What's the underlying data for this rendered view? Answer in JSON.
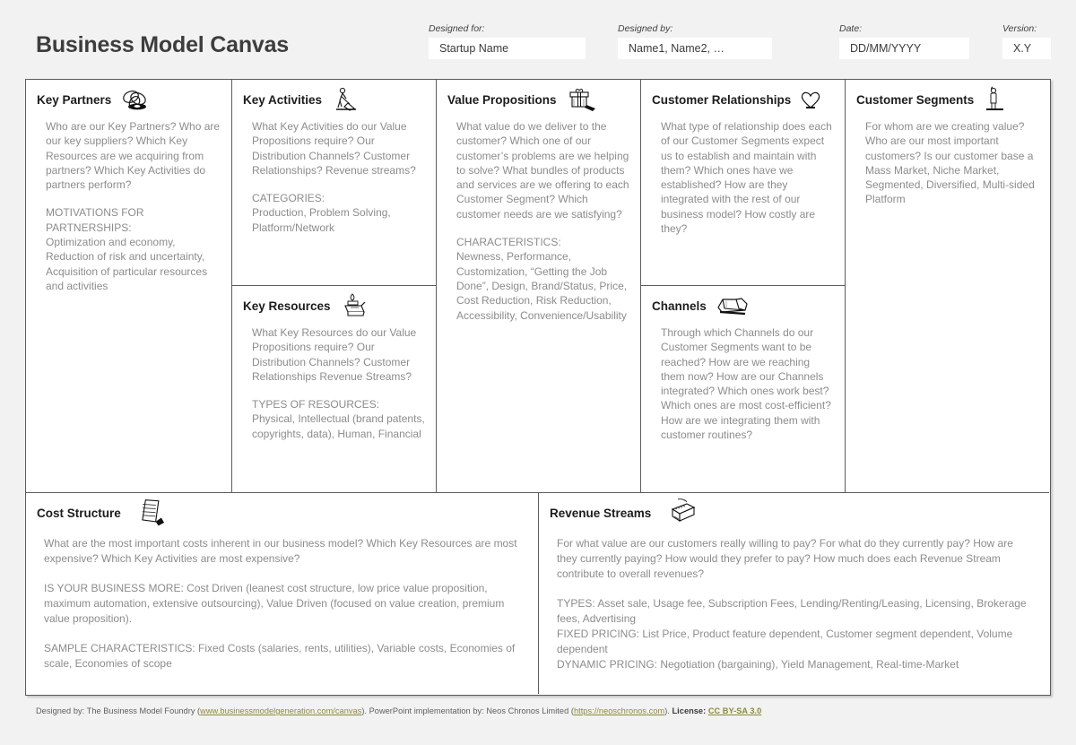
{
  "header": {
    "title": "Business Model Canvas",
    "fields": [
      {
        "label": "Designed for:",
        "value": "Startup Name"
      },
      {
        "label": "Designed by:",
        "value": "Name1, Name2, …"
      },
      {
        "label": "Date:",
        "value": "DD/MM/YYYY"
      },
      {
        "label": "Version:",
        "value": "X.Y"
      }
    ]
  },
  "blocks": {
    "key_partners": {
      "title": "Key Partners",
      "icon": "interlocking-rings-icon",
      "paragraphs": [
        "Who are our Key Partners? Who are our key suppliers? Which Key Resources are we acquiring from partners? Which Key Activities do partners perform?",
        "MOTIVATIONS FOR PARTNERSHIPS:\nOptimization and economy, Reduction of risk and uncertainty, Acquisition of particular resources and activities"
      ]
    },
    "key_activities": {
      "title": "Key Activities",
      "icon": "worker-sweeping-icon",
      "paragraphs": [
        "What Key Activities do our Value Propositions require? Our Distribution Channels? Customer Relationships? Revenue streams?",
        "CATEGORIES:\nProduction, Problem Solving, Platform/Network"
      ]
    },
    "key_resources": {
      "title": "Key Resources",
      "icon": "factory-machine-icon",
      "paragraphs": [
        "What Key Resources do our Value Propositions require? Our Distribution Channels? Customer Relationships Revenue Streams?",
        "TYPES OF RESOURCES:\nPhysical, Intellectual (brand patents, copyrights, data), Human, Financial"
      ]
    },
    "value_propositions": {
      "title": "Value Propositions",
      "icon": "gift-box-icon",
      "paragraphs": [
        "What value do we deliver to the customer? Which one of our customer’s problems are we helping to solve? What bundles of products and services are we offering to each Customer Segment? Which customer needs are we satisfying?",
        "CHARACTERISTICS:\nNewness, Performance, Customization, “Getting the Job Done”, Design, Brand/Status, Price, Cost Reduction, Risk Reduction, Accessibility, Convenience/Usability"
      ]
    },
    "customer_relationships": {
      "title": "Customer Relationships",
      "icon": "heart-icon",
      "paragraphs": [
        "What type of relationship does each of our Customer Segments expect us to establish and maintain with them? Which ones have we established? How are they integrated with the rest of our business model? How costly are they?"
      ]
    },
    "channels": {
      "title": "Channels",
      "icon": "delivery-truck-icon",
      "paragraphs": [
        "Through which Channels do our Customer Segments want to be reached? How are we reaching them now? How are our Channels integrated? Which ones work best? Which ones are most cost-efficient? How are we integrating them with customer routines?"
      ]
    },
    "customer_segments": {
      "title": "Customer Segments",
      "icon": "person-standing-icon",
      "paragraphs": [
        "For whom are we creating value? Who are our most important customers? Is our customer base a Mass Market, Niche Market, Segmented, Diversified, Multi-sided Platform"
      ]
    },
    "cost_structure": {
      "title": "Cost Structure",
      "icon": "price-tag-icon",
      "paragraphs": [
        "What are the most important costs inherent in our business model? Which Key Resources are most expensive? Which Key Activities are most expensive?",
        "IS YOUR BUSINESS MORE: Cost Driven (leanest cost structure, low price value proposition, maximum automation, extensive outsourcing), Value Driven (focused on value creation, premium value proposition).",
        "SAMPLE CHARACTERISTICS: Fixed Costs (salaries, rents, utilities), Variable costs, Economies of scale, Economies of scope"
      ]
    },
    "revenue_streams": {
      "title": "Revenue Streams",
      "icon": "cash-register-icon",
      "paragraphs": [
        "For what value are our customers really willing to pay? For what do they currently pay? How are they currently paying? How would they prefer to pay? How much does each Revenue Stream contribute to overall revenues?",
        "TYPES: Asset sale, Usage fee, Subscription Fees, Lending/Renting/Leasing, Licensing, Brokerage fees, Advertising\nFIXED PRICING: List Price, Product feature dependent, Customer segment dependent, Volume dependent\nDYNAMIC PRICING: Negotiation (bargaining), Yield Management, Real-time-Market"
      ]
    }
  },
  "footer": {
    "designed_by_prefix": "Designed by: The Business Model Foundry (",
    "designed_by_link": "www.businessmodelgeneration.com/canvas",
    "impl_text": "). PowerPoint implementation by: Neos Chronos Limited (",
    "impl_link": "https://neoschronos.com",
    "license_prefix": "). ",
    "license_label": "License:",
    "license_link": "CC BY-SA 3.0"
  },
  "colors": {
    "background": "#f2f2f2",
    "canvas_fill": "#ffffff",
    "border": "#5c5c5c",
    "title_text": "#3d3d3d",
    "body_text": "#8c8c8c",
    "link": "#8a8a3a"
  }
}
